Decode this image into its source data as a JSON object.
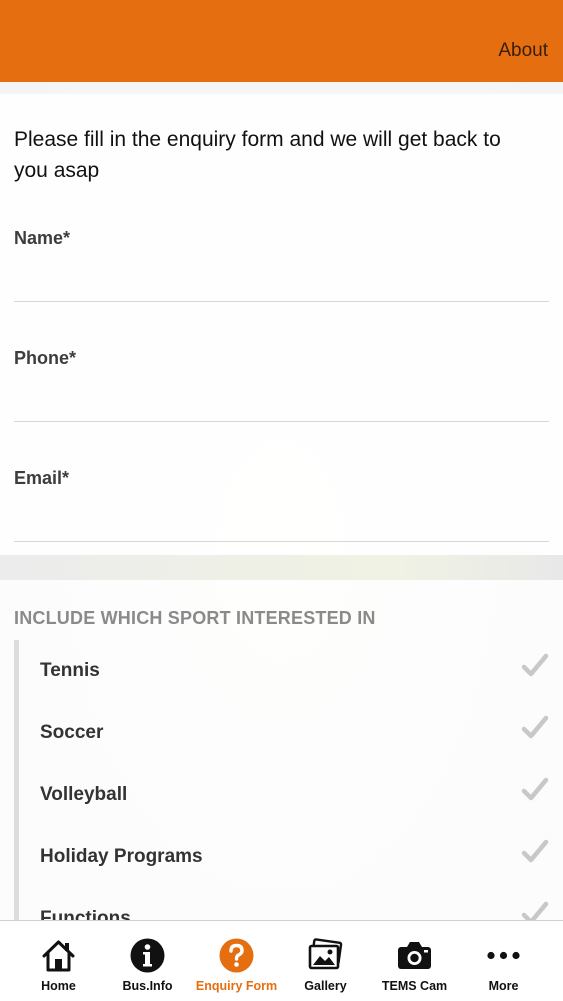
{
  "header": {
    "about_label": "About"
  },
  "form": {
    "intro": "Please fill in the enquiry form and we will get back to you asap",
    "fields": [
      {
        "label": "Name*",
        "value": "",
        "placeholder": ""
      },
      {
        "label": "Phone*",
        "value": "",
        "placeholder": ""
      },
      {
        "label": "Email*",
        "value": "",
        "placeholder": ""
      }
    ]
  },
  "sports": {
    "header": "INCLUDE WHICH SPORT INTERESTED IN",
    "items": [
      {
        "label": "Tennis"
      },
      {
        "label": "Soccer"
      },
      {
        "label": "Volleyball"
      },
      {
        "label": "Holiday Programs"
      },
      {
        "label": "Functions"
      }
    ]
  },
  "tabbar": {
    "tabs": [
      {
        "label": "Home",
        "icon": "home-icon"
      },
      {
        "label": "Bus.Info",
        "icon": "info-icon"
      },
      {
        "label": "Enquiry Form",
        "icon": "question-icon",
        "active": true
      },
      {
        "label": "Gallery",
        "icon": "gallery-icon"
      },
      {
        "label": "TEMS Cam",
        "icon": "camera-icon"
      },
      {
        "label": "More",
        "icon": "more-icon"
      }
    ]
  },
  "colors": {
    "accent": "#e56e10",
    "check": "#c8c8c8"
  }
}
